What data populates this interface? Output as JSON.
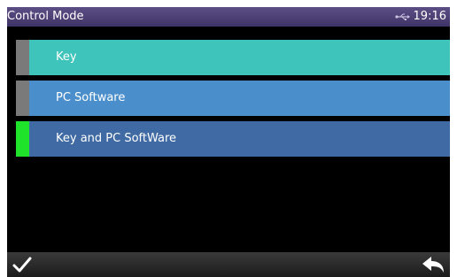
{
  "status_bar": {
    "title": "Control Mode",
    "time": "19:16",
    "usb_icon": "usb-icon"
  },
  "menu": {
    "items": [
      {
        "label": "Key",
        "color": "#3fc4bb",
        "indicator_color": "#7a7a7a",
        "selected": false
      },
      {
        "label": "PC Software",
        "color": "#4a8fcc",
        "indicator_color": "#7a7a7a",
        "selected": false
      },
      {
        "label": "Key and PC SoftWare",
        "color": "#3f6aa3",
        "indicator_color": "#1fe22b",
        "selected": true
      }
    ]
  },
  "bottom_bar": {
    "confirm_icon": "check-icon",
    "back_icon": "back-arrow-icon"
  },
  "colors": {
    "status_bar": "#4a3f74",
    "background": "#000000",
    "bottom_bar": "#2a2a2a"
  }
}
